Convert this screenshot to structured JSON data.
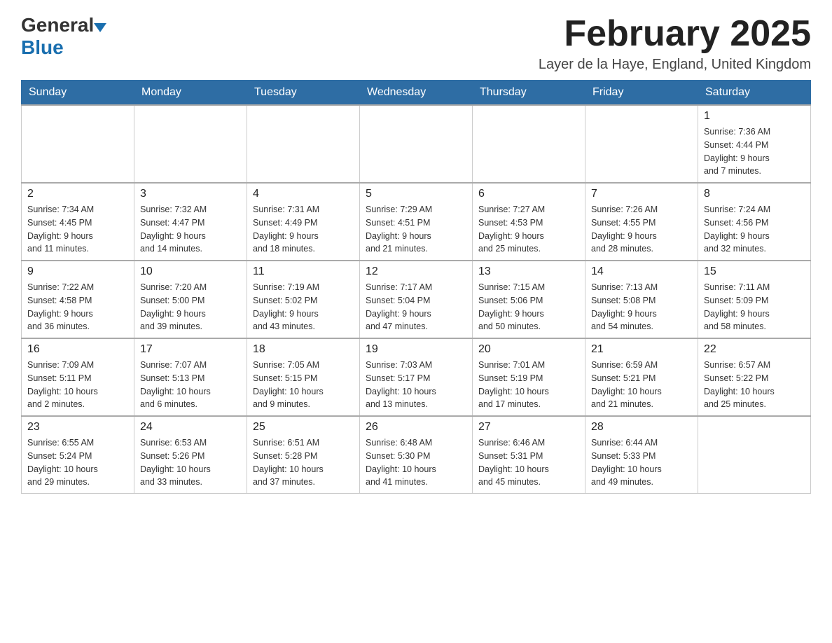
{
  "logo": {
    "general": "General",
    "blue": "Blue",
    "arrow_color": "#1a6faf"
  },
  "header": {
    "title": "February 2025",
    "subtitle": "Layer de la Haye, England, United Kingdom"
  },
  "days_of_week": [
    "Sunday",
    "Monday",
    "Tuesday",
    "Wednesday",
    "Thursday",
    "Friday",
    "Saturday"
  ],
  "weeks": [
    {
      "cells": [
        {
          "day": "",
          "info": ""
        },
        {
          "day": "",
          "info": ""
        },
        {
          "day": "",
          "info": ""
        },
        {
          "day": "",
          "info": ""
        },
        {
          "day": "",
          "info": ""
        },
        {
          "day": "",
          "info": ""
        },
        {
          "day": "1",
          "info": "Sunrise: 7:36 AM\nSunset: 4:44 PM\nDaylight: 9 hours\nand 7 minutes."
        }
      ]
    },
    {
      "cells": [
        {
          "day": "2",
          "info": "Sunrise: 7:34 AM\nSunset: 4:45 PM\nDaylight: 9 hours\nand 11 minutes."
        },
        {
          "day": "3",
          "info": "Sunrise: 7:32 AM\nSunset: 4:47 PM\nDaylight: 9 hours\nand 14 minutes."
        },
        {
          "day": "4",
          "info": "Sunrise: 7:31 AM\nSunset: 4:49 PM\nDaylight: 9 hours\nand 18 minutes."
        },
        {
          "day": "5",
          "info": "Sunrise: 7:29 AM\nSunset: 4:51 PM\nDaylight: 9 hours\nand 21 minutes."
        },
        {
          "day": "6",
          "info": "Sunrise: 7:27 AM\nSunset: 4:53 PM\nDaylight: 9 hours\nand 25 minutes."
        },
        {
          "day": "7",
          "info": "Sunrise: 7:26 AM\nSunset: 4:55 PM\nDaylight: 9 hours\nand 28 minutes."
        },
        {
          "day": "8",
          "info": "Sunrise: 7:24 AM\nSunset: 4:56 PM\nDaylight: 9 hours\nand 32 minutes."
        }
      ]
    },
    {
      "cells": [
        {
          "day": "9",
          "info": "Sunrise: 7:22 AM\nSunset: 4:58 PM\nDaylight: 9 hours\nand 36 minutes."
        },
        {
          "day": "10",
          "info": "Sunrise: 7:20 AM\nSunset: 5:00 PM\nDaylight: 9 hours\nand 39 minutes."
        },
        {
          "day": "11",
          "info": "Sunrise: 7:19 AM\nSunset: 5:02 PM\nDaylight: 9 hours\nand 43 minutes."
        },
        {
          "day": "12",
          "info": "Sunrise: 7:17 AM\nSunset: 5:04 PM\nDaylight: 9 hours\nand 47 minutes."
        },
        {
          "day": "13",
          "info": "Sunrise: 7:15 AM\nSunset: 5:06 PM\nDaylight: 9 hours\nand 50 minutes."
        },
        {
          "day": "14",
          "info": "Sunrise: 7:13 AM\nSunset: 5:08 PM\nDaylight: 9 hours\nand 54 minutes."
        },
        {
          "day": "15",
          "info": "Sunrise: 7:11 AM\nSunset: 5:09 PM\nDaylight: 9 hours\nand 58 minutes."
        }
      ]
    },
    {
      "cells": [
        {
          "day": "16",
          "info": "Sunrise: 7:09 AM\nSunset: 5:11 PM\nDaylight: 10 hours\nand 2 minutes."
        },
        {
          "day": "17",
          "info": "Sunrise: 7:07 AM\nSunset: 5:13 PM\nDaylight: 10 hours\nand 6 minutes."
        },
        {
          "day": "18",
          "info": "Sunrise: 7:05 AM\nSunset: 5:15 PM\nDaylight: 10 hours\nand 9 minutes."
        },
        {
          "day": "19",
          "info": "Sunrise: 7:03 AM\nSunset: 5:17 PM\nDaylight: 10 hours\nand 13 minutes."
        },
        {
          "day": "20",
          "info": "Sunrise: 7:01 AM\nSunset: 5:19 PM\nDaylight: 10 hours\nand 17 minutes."
        },
        {
          "day": "21",
          "info": "Sunrise: 6:59 AM\nSunset: 5:21 PM\nDaylight: 10 hours\nand 21 minutes."
        },
        {
          "day": "22",
          "info": "Sunrise: 6:57 AM\nSunset: 5:22 PM\nDaylight: 10 hours\nand 25 minutes."
        }
      ]
    },
    {
      "cells": [
        {
          "day": "23",
          "info": "Sunrise: 6:55 AM\nSunset: 5:24 PM\nDaylight: 10 hours\nand 29 minutes."
        },
        {
          "day": "24",
          "info": "Sunrise: 6:53 AM\nSunset: 5:26 PM\nDaylight: 10 hours\nand 33 minutes."
        },
        {
          "day": "25",
          "info": "Sunrise: 6:51 AM\nSunset: 5:28 PM\nDaylight: 10 hours\nand 37 minutes."
        },
        {
          "day": "26",
          "info": "Sunrise: 6:48 AM\nSunset: 5:30 PM\nDaylight: 10 hours\nand 41 minutes."
        },
        {
          "day": "27",
          "info": "Sunrise: 6:46 AM\nSunset: 5:31 PM\nDaylight: 10 hours\nand 45 minutes."
        },
        {
          "day": "28",
          "info": "Sunrise: 6:44 AM\nSunset: 5:33 PM\nDaylight: 10 hours\nand 49 minutes."
        },
        {
          "day": "",
          "info": ""
        }
      ]
    }
  ]
}
